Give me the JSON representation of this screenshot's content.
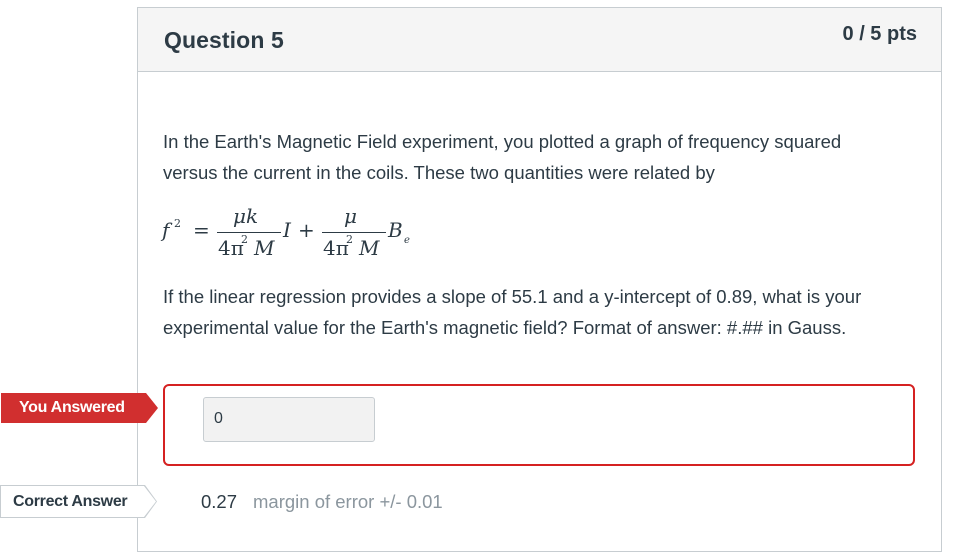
{
  "question": {
    "title": "Question 5",
    "points": "0 / 5 pts",
    "text_line1": "In the Earth's Magnetic Field experiment, you plotted a graph of frequency squared",
    "text_line2": "versus the current in the coils.  These two quantities were related by",
    "formula": {
      "lhs": "f",
      "lhs_exp": "2",
      "eq": "=",
      "num1": "μk",
      "den1": "4π",
      "den1_exp": "2",
      "den1_tail": "M",
      "var1": "I",
      "plus": "+",
      "num2": "μ",
      "den2": "4π",
      "den2_exp": "2",
      "den2_tail": "M",
      "var2": "B",
      "var2_sub": "e"
    },
    "text_line3": "If the linear regression provides a slope of 55.1 and a y-intercept of 0.89, what is your",
    "text_line4": "experimental value for the Earth's magnetic field?  Format of answer: #.## in Gauss."
  },
  "answer": {
    "tag_label": "You Answered",
    "value": "0"
  },
  "correct": {
    "tag_label": "Correct Answer",
    "value": "0.27",
    "margin": "margin of error +/- 0.01"
  },
  "colors": {
    "accent_red": "#d52121",
    "tag_red": "#d12f2f",
    "text": "#2d3b45",
    "muted": "#8b969e",
    "header_bg": "#f5f5f5",
    "border": "#c7cdd1"
  }
}
